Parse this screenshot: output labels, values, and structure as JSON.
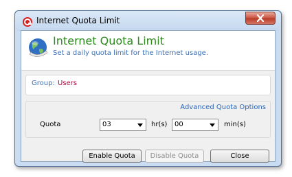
{
  "window": {
    "title": "Internet Quota Limit",
    "close_symbol": "✕"
  },
  "header": {
    "title": "Internet Quota Limit",
    "subtitle": "Set a daily quota limit for the Internet usage."
  },
  "group": {
    "label": "Group:",
    "value": "Users"
  },
  "quota": {
    "advanced_link": "Advanced Quota Options",
    "label": "Quota",
    "hours_value": "03",
    "hours_unit": "hr(s)",
    "minutes_value": "00",
    "minutes_unit": "min(s)"
  },
  "buttons": {
    "enable": "Enable Quota",
    "disable": "Disable Quota",
    "close": "Close"
  },
  "colors": {
    "title_green": "#2f8a1f",
    "link_blue": "#2a64b8",
    "group_value_red": "#b0003a"
  }
}
